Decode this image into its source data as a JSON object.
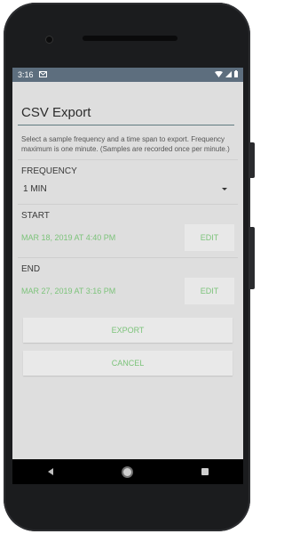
{
  "status_bar": {
    "time": "3:16",
    "notification_icon": "message-icon",
    "icons": [
      "wifi-icon",
      "signal-icon",
      "battery-icon"
    ]
  },
  "screen": {
    "title": "CSV Export",
    "description": "Select a sample frequency and a time span to export. Frequency maximum is one minute. (Samples are recorded once per minute.)"
  },
  "frequency": {
    "label": "FREQUENCY",
    "value": "1 MIN"
  },
  "start": {
    "label": "START",
    "date": "MAR 18, 2019 AT 4:40 PM",
    "edit_label": "EDIT"
  },
  "end": {
    "label": "END",
    "date": "MAR 27, 2019 AT 3:16 PM",
    "edit_label": "EDIT"
  },
  "actions": {
    "export_label": "EXPORT",
    "cancel_label": "CANCEL"
  },
  "colors": {
    "status_bar": "#5d6e7e",
    "accent_green": "#7cc37a",
    "background": "#dedede"
  }
}
